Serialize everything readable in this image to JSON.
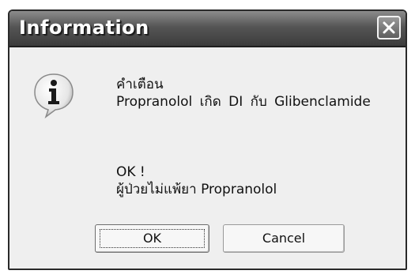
{
  "dialog": {
    "title": "Information",
    "message_heading": "คำเตือน",
    "message_line": "Propranolol เกิด DI กับ Glibenclamide",
    "status_text": "OK !",
    "status_detail": "ผู้ป่วยไม่แพ้ยา Propranolol",
    "buttons": {
      "ok_label": "OK",
      "cancel_label": "Cancel"
    }
  },
  "icons": {
    "title_close": "close-icon",
    "message": "info-icon"
  }
}
